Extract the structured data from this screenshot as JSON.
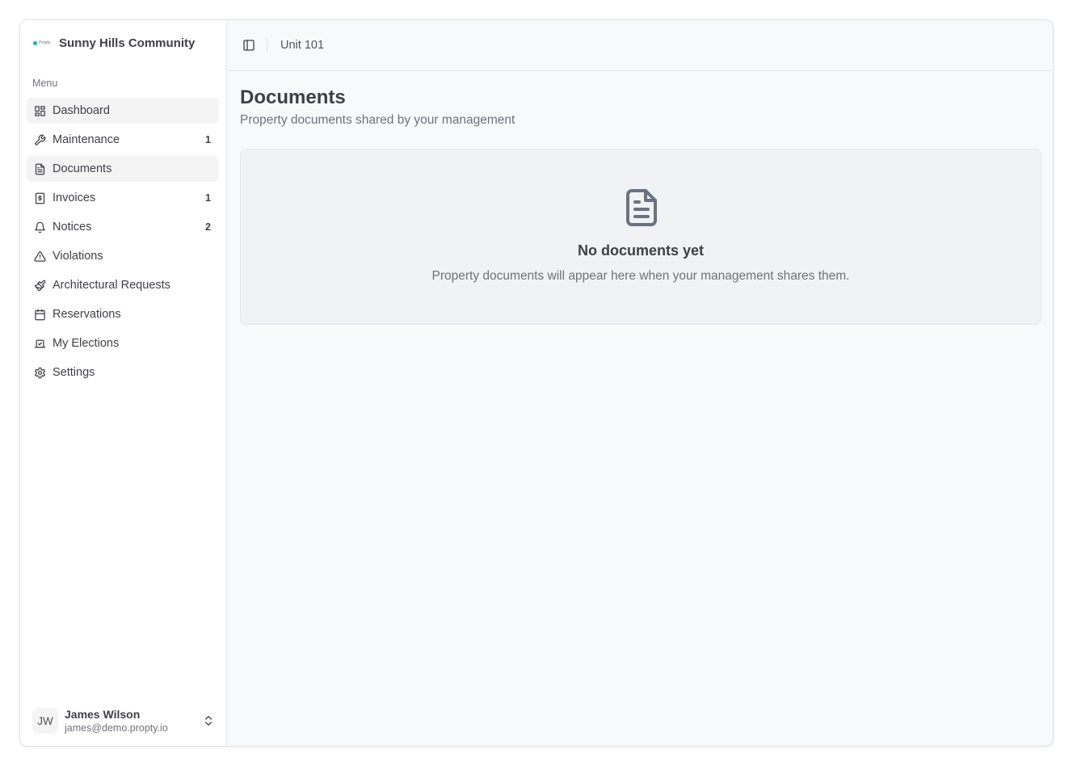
{
  "brand": {
    "logo_text": "Propty",
    "name": "Sunny Hills Community"
  },
  "sidebar": {
    "menu_label": "Menu",
    "items": [
      {
        "label": "Dashboard",
        "icon": "dashboard-icon",
        "badge": ""
      },
      {
        "label": "Maintenance",
        "icon": "wrench-icon",
        "badge": "1"
      },
      {
        "label": "Documents",
        "icon": "document-icon",
        "badge": ""
      },
      {
        "label": "Invoices",
        "icon": "invoice-icon",
        "badge": "1"
      },
      {
        "label": "Notices",
        "icon": "bell-icon",
        "badge": "2"
      },
      {
        "label": "Violations",
        "icon": "warning-icon",
        "badge": ""
      },
      {
        "label": "Architectural Requests",
        "icon": "paintbrush-icon",
        "badge": ""
      },
      {
        "label": "Reservations",
        "icon": "calendar-icon",
        "badge": ""
      },
      {
        "label": "My Elections",
        "icon": "ballot-icon",
        "badge": ""
      },
      {
        "label": "Settings",
        "icon": "gear-icon",
        "badge": ""
      }
    ],
    "active_item": "Documents"
  },
  "user": {
    "initials": "JW",
    "name": "James Wilson",
    "email": "james@demo.propty.io"
  },
  "header": {
    "breadcrumb": "Unit 101"
  },
  "page": {
    "title": "Documents",
    "subtitle": "Property documents shared by your management"
  },
  "empty_state": {
    "icon": "file-text-icon",
    "title": "No documents yet",
    "description": "Property documents will appear here when your management shares them."
  },
  "colors": {
    "accent_teal": "#14b8a6",
    "text": "#3f3f46",
    "muted": "#71717a",
    "background": "#f8f9fb"
  }
}
